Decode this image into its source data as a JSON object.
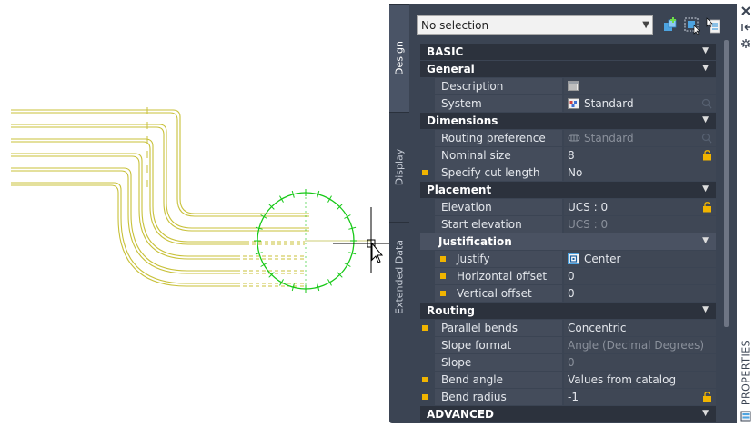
{
  "selection": {
    "value": "No selection"
  },
  "tabs": [
    "Design",
    "Display",
    "Extended Data"
  ],
  "sections": {
    "basic": "BASIC",
    "general": "General",
    "dimensions": "Dimensions",
    "placement": "Placement",
    "justification": "Justification",
    "routing": "Routing",
    "advanced": "ADVANCED"
  },
  "properties": {
    "description": {
      "label": "Description",
      "value": ""
    },
    "system": {
      "label": "System",
      "value": "Standard"
    },
    "routing_preference": {
      "label": "Routing preference",
      "value": "Standard"
    },
    "nominal_size": {
      "label": "Nominal size",
      "value": "8"
    },
    "specify_cut_length": {
      "label": "Specify cut length",
      "value": "No"
    },
    "elevation": {
      "label": "Elevation",
      "value": "UCS : 0"
    },
    "start_elevation": {
      "label": "Start elevation",
      "value": "UCS : 0"
    },
    "justify": {
      "label": "Justify",
      "value": "Center"
    },
    "horizontal_offset": {
      "label": "Horizontal offset",
      "value": "0"
    },
    "vertical_offset": {
      "label": "Vertical offset",
      "value": "0"
    },
    "parallel_bends": {
      "label": "Parallel bends",
      "value": "Concentric"
    },
    "slope_format": {
      "label": "Slope format",
      "value": "Angle (Decimal Degrees)"
    },
    "slope": {
      "label": "Slope",
      "value": "0"
    },
    "bend_angle": {
      "label": "Bend angle",
      "value": "Values from catalog"
    },
    "bend_radius": {
      "label": "Bend radius",
      "value": "-1"
    }
  },
  "sidebar": {
    "label": "PROPERTIES"
  },
  "colors": {
    "pipe": "#c8c13a",
    "circle": "#18c918",
    "panel": "#3b4453",
    "header": "#2c323d"
  }
}
